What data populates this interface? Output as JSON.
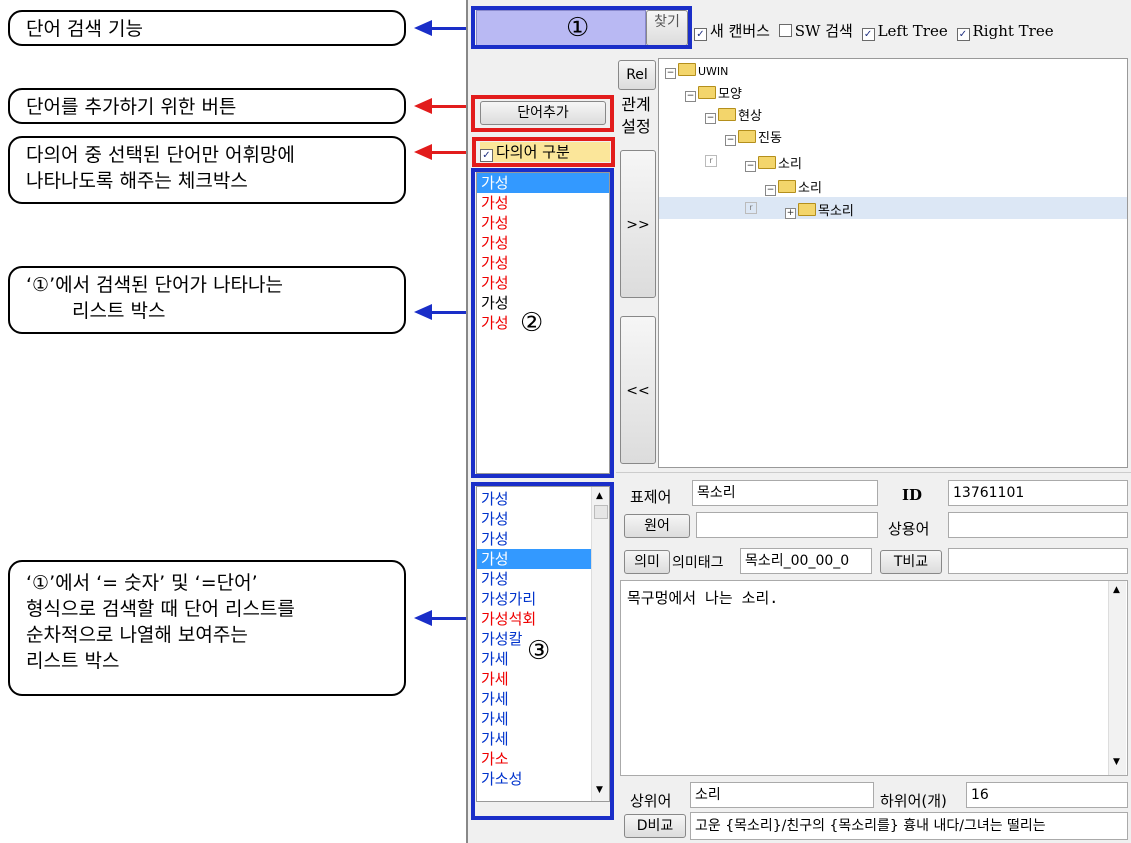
{
  "callouts": {
    "c1": "단어 검색 기능",
    "c2": "단어를 추가하기 위한 버튼",
    "c3_line1": "다의어 중 선택된 단어만 어휘망에",
    "c3_line2": "나타나도록 해주는 체크박스",
    "c4_line1": "‘①’에서 검색된 단어가 나타나는",
    "c4_line2": "리스트 박스",
    "c5_line1": "‘①’에서 ‘= 숫자’ 및 ‘=단어’",
    "c5_line2": "형식으로 검색할 때 단어 리스트를",
    "c5_line3": "순차적으로 나열해 보여주는",
    "c5_line4": "리스트 박스"
  },
  "markers": {
    "m1": "①",
    "m2": "②",
    "m3": "③"
  },
  "toolbar": {
    "search_button": "찾기",
    "new_canvas": "새 캔버스",
    "sw_search": "SW 검색",
    "left_tree": "Left Tree",
    "right_tree": "Right Tree",
    "new_canvas_checked": true,
    "sw_search_checked": false,
    "left_tree_checked": true,
    "right_tree_checked": true
  },
  "add_word_button": "단어추가",
  "polysemy_checkbox": {
    "label": "다의어 구분",
    "checked": true
  },
  "rel_button": "Rel",
  "relation_label_line1": "관계",
  "relation_label_line2": "설정",
  "move_right_button": ">>",
  "move_left_button": "<<",
  "tree": {
    "root": "UWIN",
    "n1": "모양",
    "n2": "현상",
    "n3": "진동",
    "n4": "소리",
    "n5": "소리",
    "n6": "목소리"
  },
  "list1": [
    {
      "text": "가성",
      "color": "blue",
      "selected": true
    },
    {
      "text": "가성",
      "color": "red"
    },
    {
      "text": "가성",
      "color": "red"
    },
    {
      "text": "가성",
      "color": "red"
    },
    {
      "text": "가성",
      "color": "red"
    },
    {
      "text": "가성",
      "color": "red"
    },
    {
      "text": "가성",
      "color": "black"
    },
    {
      "text": "가성",
      "color": "red"
    }
  ],
  "list2": [
    {
      "text": "가성",
      "color": "blue"
    },
    {
      "text": "가성",
      "color": "blue"
    },
    {
      "text": "가성",
      "color": "blue"
    },
    {
      "text": "가성",
      "color": "blue",
      "selected": true
    },
    {
      "text": "가성",
      "color": "blue"
    },
    {
      "text": "가성가리",
      "color": "blue"
    },
    {
      "text": "가성석회",
      "color": "red"
    },
    {
      "text": "가성칼",
      "color": "blue"
    },
    {
      "text": "가세",
      "color": "blue"
    },
    {
      "text": "가세",
      "color": "red"
    },
    {
      "text": "가세",
      "color": "blue"
    },
    {
      "text": "가세",
      "color": "blue"
    },
    {
      "text": "가세",
      "color": "blue"
    },
    {
      "text": "가소",
      "color": "red"
    },
    {
      "text": "가소성",
      "color": "blue"
    }
  ],
  "detail": {
    "headword_label": "표제어",
    "headword_value": "목소리",
    "id_label": "ID",
    "id_value": "13761101",
    "origin_button": "원어",
    "origin_value": "",
    "common_label": "상용어",
    "common_value": "",
    "meaning_button": "의미",
    "meaning_tag_label": "의미태그",
    "meaning_tag_value": "목소리_00_00_0",
    "tcompare_button": "T비교",
    "tcompare_value": "",
    "definition": "목구멍에서 나는 소리.",
    "hypernym_label": "상위어",
    "hypernym_value": "소리",
    "hyponym_label": "하위어(개)",
    "hyponym_value": "16",
    "dcompare_button": "D비교",
    "example": "고운 {목소리}/친구의 {목소리를} 흉내 내다/그녀는 떨리는"
  },
  "colors": {
    "arrow_blue": "#1a2ec8",
    "arrow_red": "#e21c1c",
    "search_bg": "#b9b9f3",
    "select_bg": "#3399ff",
    "tree_select_bg": "#dce7f5"
  }
}
